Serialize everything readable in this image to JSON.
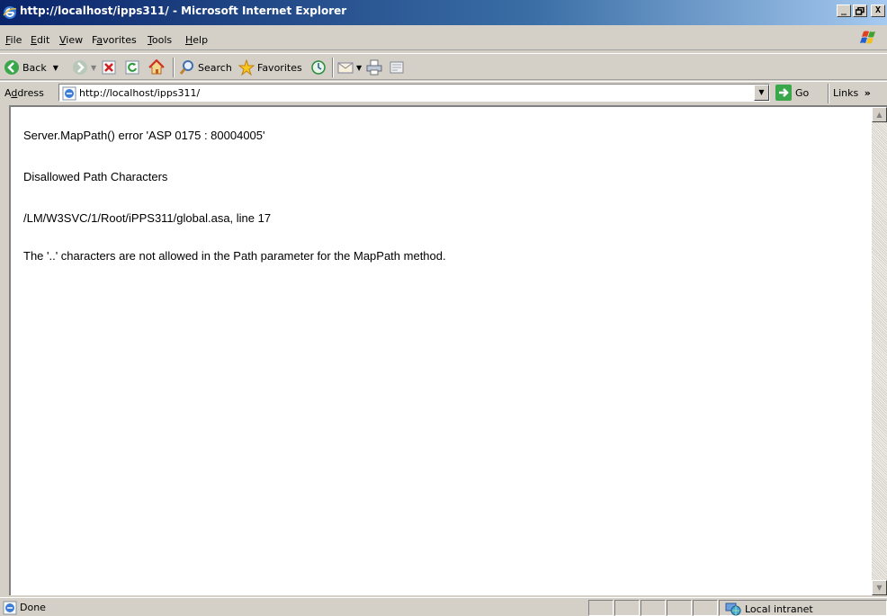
{
  "window": {
    "title": "http://localhost/ipps311/ - Microsoft Internet Explorer",
    "title_icon": "ie-icon",
    "controls": {
      "minimize": "_",
      "maximize": "□",
      "close": "X"
    }
  },
  "menubar": {
    "items": [
      "File",
      "Edit",
      "View",
      "Favorites",
      "Tools",
      "Help"
    ],
    "mnemonics": [
      "F",
      "E",
      "V",
      "a",
      "T",
      "H"
    ]
  },
  "toolbar": {
    "back_label": "Back",
    "search_label": "Search",
    "favorites_label": "Favorites"
  },
  "addressbar": {
    "label": "Address",
    "mnemonic": "d",
    "url": "http://localhost/ipps311/",
    "go_label": "Go",
    "links_label": "Links",
    "links_chevron": "»"
  },
  "page": {
    "lines": [
      "Server.MapPath() error 'ASP 0175 : 80004005'",
      "Disallowed Path Characters",
      "/LM/W3SVC/1/Root/iPPS311/global.asa, line 17",
      "The '..' characters are not allowed in the Path parameter for the MapPath method."
    ]
  },
  "statusbar": {
    "status": "Done",
    "zone": "Local intranet"
  },
  "colors": {
    "titlebar_start": "#0a246a",
    "titlebar_end": "#a6caf0",
    "chrome": "#d4d0c8",
    "content_bg": "#ffffff"
  }
}
